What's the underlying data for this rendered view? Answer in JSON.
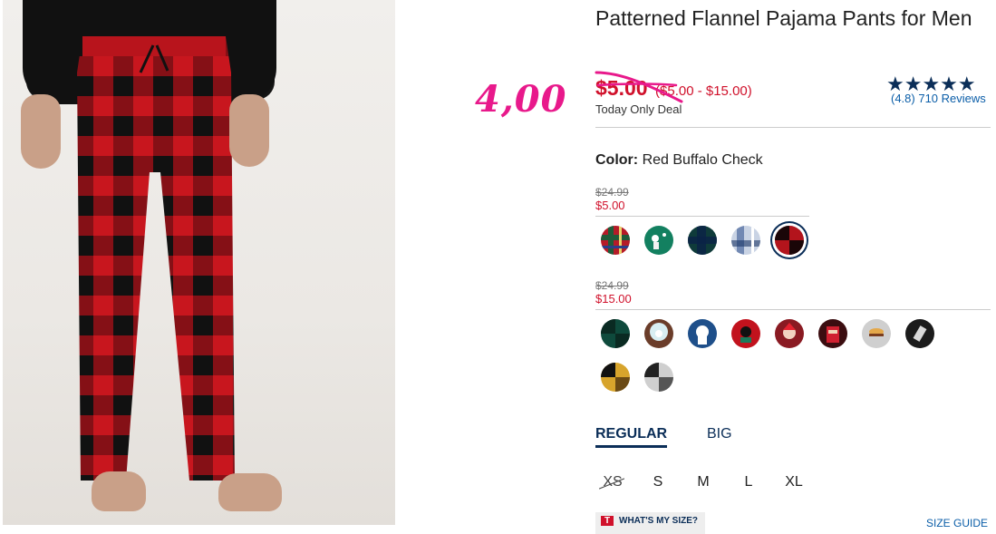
{
  "product": {
    "title": "Patterned Flannel Pajama Pants for Men",
    "sale_price": "$5.00",
    "price_range": "($5.00 - $15.00)",
    "deal_label": "Today Only Deal",
    "handwritten_note": "4,00",
    "rating_stars": "★★★★★",
    "reviews_text": "(4.8) 710 Reviews"
  },
  "color": {
    "label": "Color:",
    "value": "Red Buffalo Check"
  },
  "price_groups": [
    {
      "was": "$24.99",
      "now": "$5.00"
    },
    {
      "was": "$24.99",
      "now": "$15.00"
    }
  ],
  "tabs": {
    "regular": "REGULAR",
    "big": "BIG"
  },
  "sizes": [
    "XS",
    "S",
    "M",
    "L",
    "XL"
  ],
  "size_help": {
    "icon_letter": "T",
    "whats_my_size": "WHAT'S MY SIZE?",
    "size_guide": "SIZE GUIDE"
  },
  "colors": {
    "accent_navy": "#0b2e58",
    "sale_red": "#d0112b",
    "note_pink": "#e8198b"
  }
}
